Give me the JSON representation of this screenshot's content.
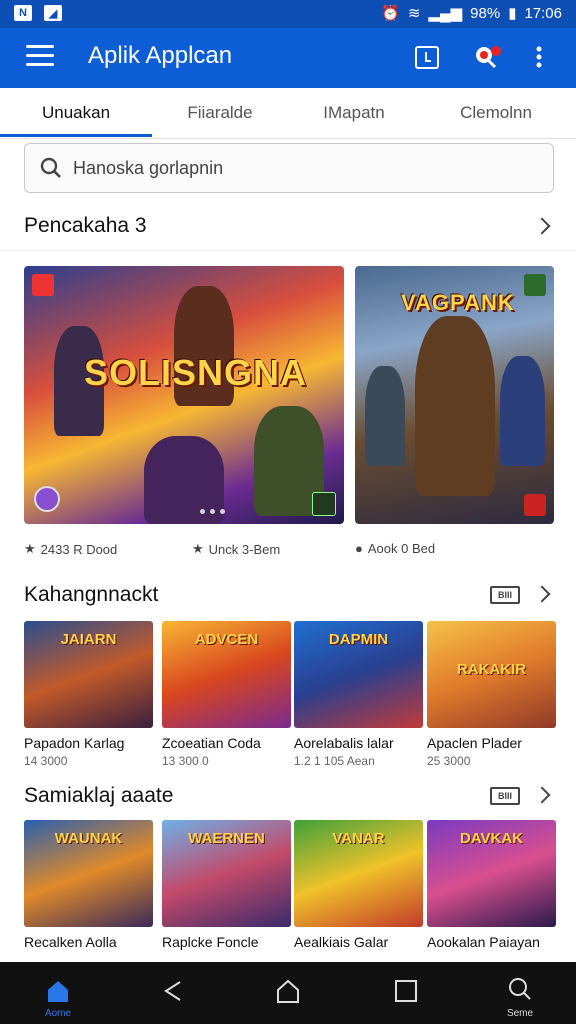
{
  "status_bar": {
    "battery": "98%",
    "time": "17:06"
  },
  "app_bar": {
    "title": "Aplik Applcan"
  },
  "tabs": [
    {
      "label": "Unuakan"
    },
    {
      "label": "Fiiaralde"
    },
    {
      "label": "IMapatn"
    },
    {
      "label": "Clemolnn"
    }
  ],
  "search": {
    "placeholder": "Hanoska gorlapnin"
  },
  "section1": {
    "title": "Pencakaha 3",
    "featured": [
      {
        "title": "SOLISNGNA"
      },
      {
        "title": "VAGPANK"
      }
    ],
    "meta": [
      {
        "text": "2433 R Dood"
      },
      {
        "text": "Unck 3-Bem"
      },
      {
        "text": "Aook 0 Bed"
      }
    ]
  },
  "section2": {
    "title": "Kahangnnackt",
    "badge": "BIII",
    "items": [
      {
        "thumb": "JAIARN",
        "name": "Papadon Karlag",
        "sub": "14 3000"
      },
      {
        "thumb": "ADVCEN",
        "name": "Zcoeatian Coda",
        "sub": "13 300 0"
      },
      {
        "thumb": "DAPMIN",
        "name": "Aorelabalis lalar",
        "sub": "1.2 1 105 Aean"
      },
      {
        "thumb": "RAKAKIR",
        "name": "Apaclen Plader",
        "sub": "25 3000"
      }
    ]
  },
  "section3": {
    "title": "Samiaklaj aaate",
    "badge": "BIII",
    "items": [
      {
        "thumb": "WAUNAK",
        "name": "Recalken Aolla"
      },
      {
        "thumb": "WAERNEN",
        "name": "Raplcke Foncle"
      },
      {
        "thumb": "VANAR",
        "name": "Aealkiais Galar"
      },
      {
        "thumb": "DAVKAK",
        "name": "Aookalan Paiayan"
      }
    ]
  },
  "bottom_nav": [
    {
      "label": "Aome",
      "icon": "home-icon"
    },
    {
      "label": "",
      "icon": "back-icon"
    },
    {
      "label": "",
      "icon": "home-outline-icon"
    },
    {
      "label": "",
      "icon": "recents-icon"
    },
    {
      "label": "Seme",
      "icon": "search-icon"
    }
  ],
  "colors": {
    "primary": "#0d5ed6",
    "status": "#0d4fb5",
    "navbar": "#111111"
  }
}
